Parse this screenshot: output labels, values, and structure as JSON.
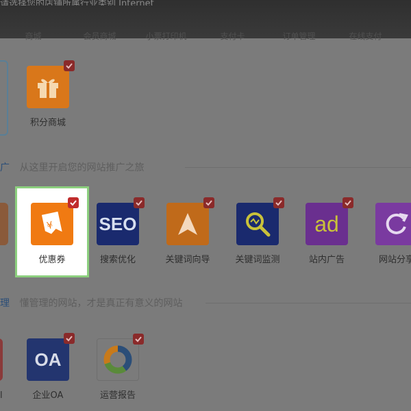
{
  "header": {
    "title_partial": "请选择您的店铺所属行业类别 Internet",
    "tabs": [
      "商城",
      "会员商城",
      "小票打印机",
      "支付卡",
      "订单管理",
      "在线支付"
    ]
  },
  "sections": {
    "promo": {
      "prefix": "广",
      "title": "从这里开启您的网站推广之旅"
    },
    "manage": {
      "prefix": "理",
      "title": "懂管理的网站，才是真正有意义的网站"
    }
  },
  "apps_row1": [
    {
      "label": "积分商城",
      "icon": "gift-icon"
    }
  ],
  "apps_row2": [
    {
      "label": "优惠券",
      "icon": "coupon-icon",
      "text": "¥"
    },
    {
      "label": "搜索优化",
      "icon": "seo-icon",
      "text": "SEO"
    },
    {
      "label": "关键词向导",
      "icon": "arrow-nav-icon"
    },
    {
      "label": "关键词监测",
      "icon": "magnifier-icon"
    },
    {
      "label": "站内广告",
      "icon": "ad-icon",
      "text": "ad"
    },
    {
      "label": "网站分享",
      "icon": "share-icon"
    }
  ],
  "apps_row3": [
    {
      "label": "企业OA",
      "icon": "oa-icon",
      "text": "OA"
    },
    {
      "label": "运营报告",
      "icon": "report-ring-icon"
    }
  ],
  "partial_labels": {
    "row3_left": "l"
  },
  "colors": {
    "overlay": "#7b7b7b",
    "check": "#8a2a2a",
    "selected_border": "#8ccf7e",
    "orange": "#d9771a",
    "navy": "#1a2a6e",
    "purple": "#7a3aa0"
  }
}
